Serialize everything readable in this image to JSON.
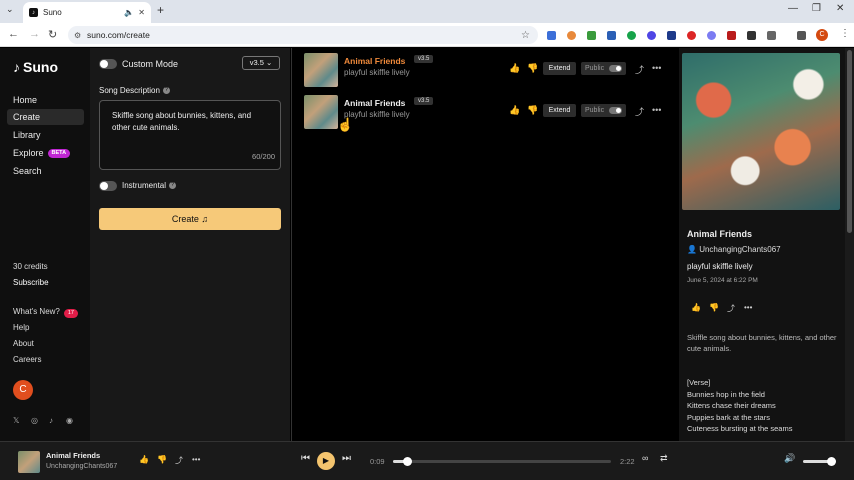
{
  "browser": {
    "tab_title": "Suno",
    "url": "suno.com/create"
  },
  "sidebar": {
    "logo": "Suno",
    "nav": [
      {
        "label": "Home"
      },
      {
        "label": "Create"
      },
      {
        "label": "Library"
      },
      {
        "label": "Explore",
        "badge": "BETA"
      },
      {
        "label": "Search"
      }
    ],
    "credits": "30 credits",
    "subscribe": "Subscribe",
    "whats_new": "What's New?",
    "whats_new_count": "17",
    "help": "Help",
    "about": "About",
    "careers": "Careers",
    "avatar_letter": "C"
  },
  "create_panel": {
    "custom_mode": "Custom Mode",
    "version": "v3.5",
    "song_description_label": "Song Description",
    "song_description_value": "Skiffle song about bunnies, kittens, and other cute animals.",
    "char_count": "60/200",
    "instrumental": "Instrumental",
    "create_button": "Create"
  },
  "songs": [
    {
      "title": "Animal Friends",
      "version": "v3.5",
      "tags": "playful skiffle lively",
      "extend": "Extend",
      "visibility": "Public"
    },
    {
      "title": "Animal Friends",
      "version": "v3.5",
      "tags": "playful skiffle lively",
      "extend": "Extend",
      "visibility": "Public"
    }
  ],
  "detail": {
    "title": "Animal Friends",
    "user": "UnchangingChants067",
    "style": "playful skiffle lively",
    "date": "June 5, 2024 at 6:22 PM",
    "description": "Skiffle song about bunnies, kittens, and other cute animals.",
    "lyrics": [
      "[Verse]",
      "Bunnies hop in the field",
      "Kittens chase their dreams",
      "Puppies bark at the stars",
      "Cuteness bursting at the seams"
    ]
  },
  "player": {
    "title": "Animal Friends",
    "user": "UnchangingChants067",
    "current_time": "0:09",
    "total_time": "2:22",
    "progress_fraction": 0.063,
    "volume_fraction": 0.95
  },
  "colors": {
    "accent": "#f6c979",
    "song_title_active": "#f08a3b",
    "beta_badge": "#c026d3",
    "notification_badge": "#e11d48"
  }
}
